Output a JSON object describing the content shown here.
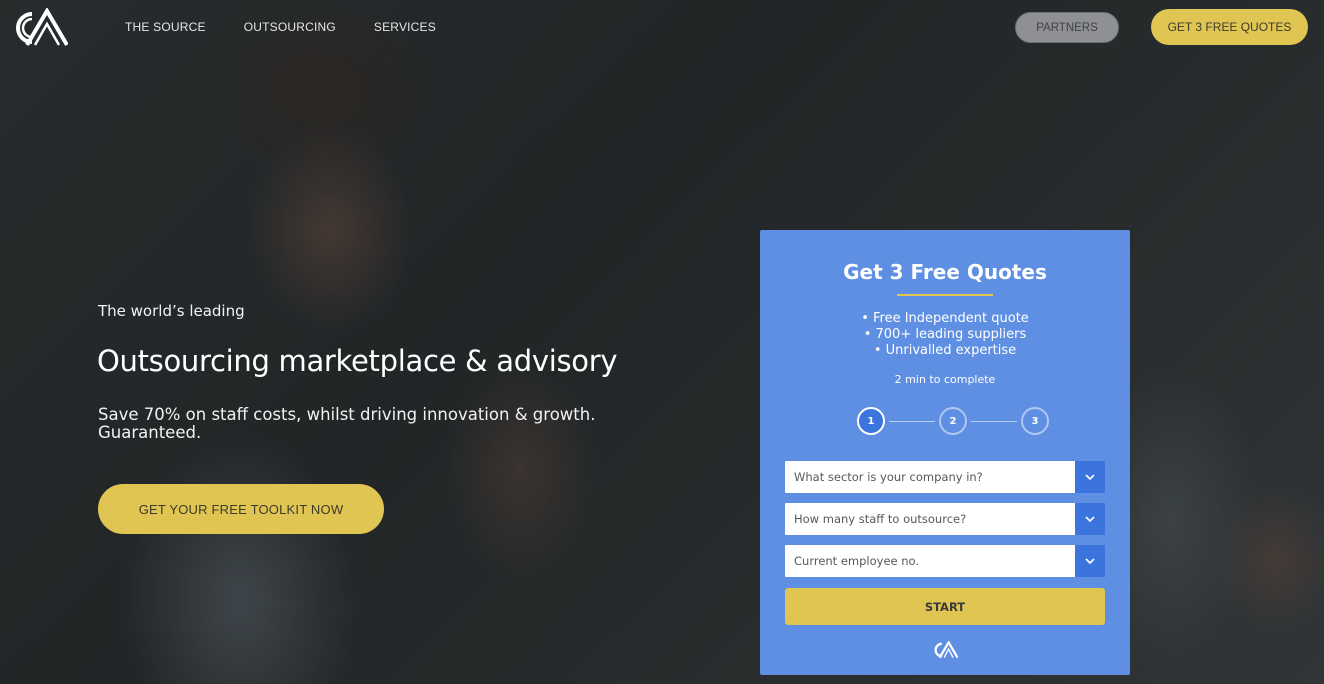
{
  "header": {
    "logo_alt": "CA",
    "nav": [
      {
        "label": "THE SOURCE"
      },
      {
        "label": "OUTSOURCING"
      },
      {
        "label": "SERVICES"
      }
    ],
    "partners_label": "PARTNERS",
    "quotes_label": "GET 3 FREE QUOTES"
  },
  "hero": {
    "kicker": "The world’s leading",
    "headline": "Outsourcing marketplace & advisory",
    "subline": "Save 70% on staff costs, whilst driving innovation & growth. Guaranteed.",
    "cta_label": "GET YOUR FREE TOOLKIT NOW"
  },
  "quote_form": {
    "title": "Get 3 Free Quotes",
    "bullets": [
      "• Free Independent quote",
      "• 700+ leading suppliers",
      "• Unrivalled expertise"
    ],
    "time_note": "2 min to complete",
    "steps": [
      "1",
      "2",
      "3"
    ],
    "active_step": 1,
    "selects": [
      {
        "placeholder": "What sector is your company in?"
      },
      {
        "placeholder": "How many staff to outsource?"
      },
      {
        "placeholder": "Current employee no."
      }
    ],
    "start_label": "START"
  },
  "colors": {
    "accent_yellow": "#e0c552",
    "form_blue": "#5e8fe3",
    "control_blue": "#3b74dd"
  }
}
